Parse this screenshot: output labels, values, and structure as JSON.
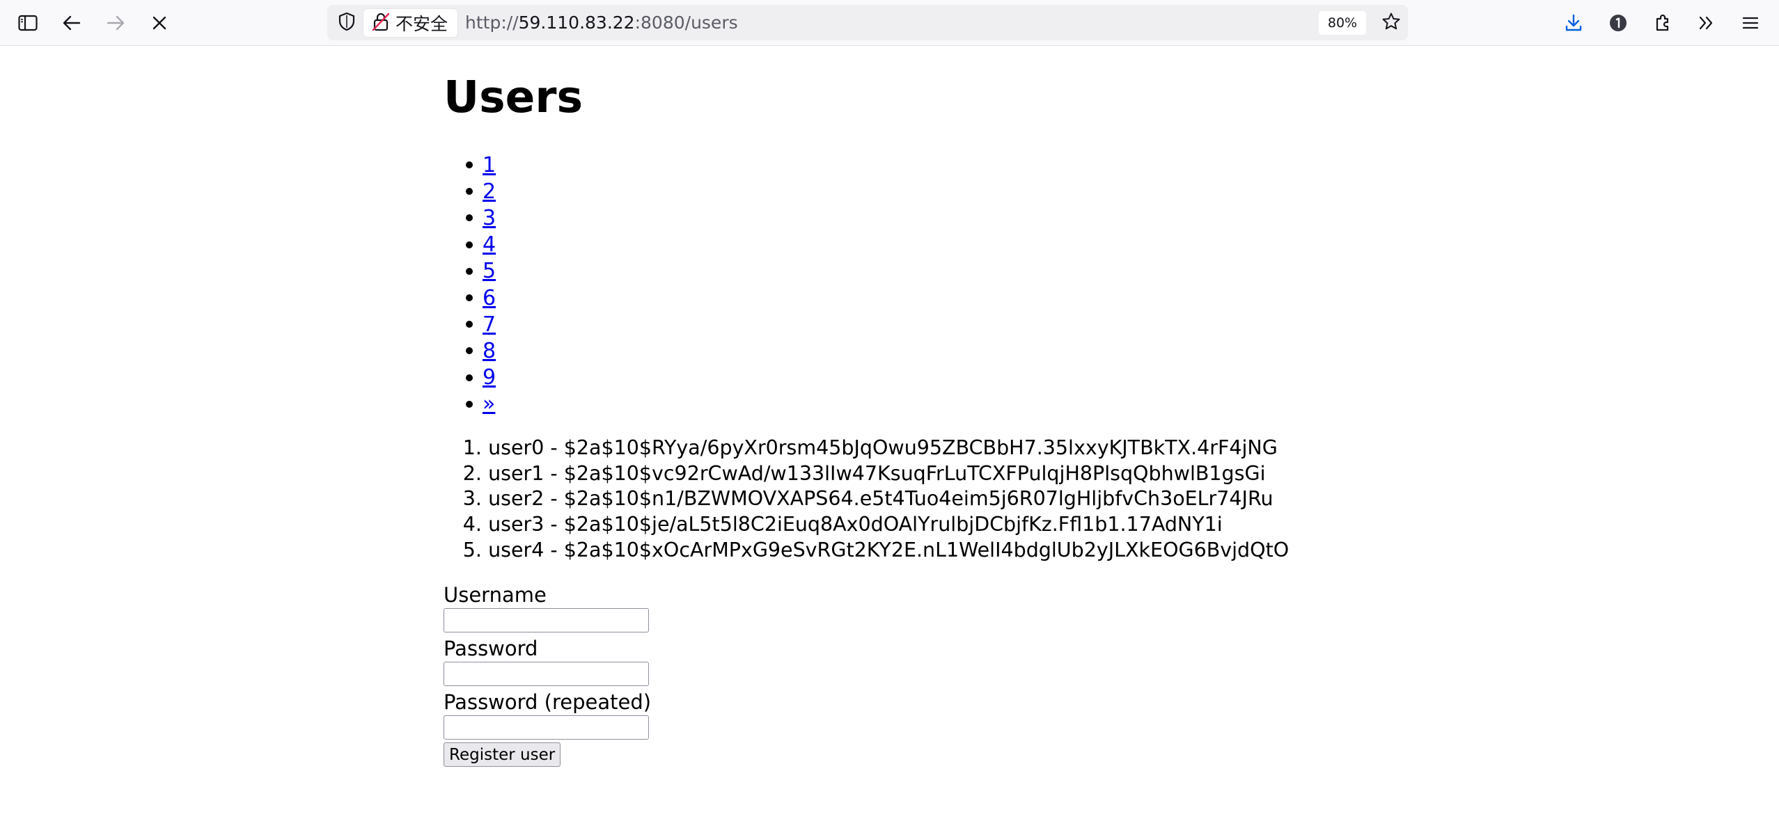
{
  "browser": {
    "insecure_label": "不安全",
    "url_protocol": "http://",
    "url_host": "59.110.83.22",
    "url_path": ":8080/users",
    "zoom": "80%",
    "icons": {
      "sidebar": "sidebar-icon",
      "back": "back-arrow-icon",
      "forward": "forward-arrow-icon",
      "stop": "stop-loading-icon",
      "shield": "shield-icon",
      "lock": "insecure-lock-icon",
      "bookmark": "star-icon",
      "downloads": "download-icon",
      "password": "password-manager-icon",
      "extensions": "extensions-icon",
      "overflow": "overflow-chevrons-icon",
      "menu": "hamburger-menu-icon"
    },
    "accent_color": "#0060df"
  },
  "page": {
    "title": "Users",
    "pagination": [
      "1",
      "2",
      "3",
      "4",
      "5",
      "6",
      "7",
      "8",
      "9",
      "»"
    ],
    "users": [
      {
        "num": "1.",
        "text": "user0 - $2a$10$RYya/6pyXr0rsm45bJqOwu95ZBCBbH7.35lxxyKJTBkTX.4rF4jNG"
      },
      {
        "num": "2.",
        "text": "user1 - $2a$10$vc92rCwAd/w133lIw47KsuqFrLuTCXFPulqjH8PlsqQbhwlB1gsGi"
      },
      {
        "num": "3.",
        "text": "user2 - $2a$10$n1/BZWMOVXAPS64.e5t4Tuo4eim5j6R07lgHljbfvCh3oELr74JRu"
      },
      {
        "num": "4.",
        "text": "user3 - $2a$10$je/aL5t5l8C2iEuq8Ax0dOAlYrulbjDCbjfKz.Ffl1b1.17AdNY1i"
      },
      {
        "num": "5.",
        "text": "user4 - $2a$10$xOcArMPxG9eSvRGt2KY2E.nL1WelI4bdglUb2yJLXkEOG6BvjdQtO"
      }
    ],
    "form": {
      "username_label": "Username",
      "username_value": "",
      "password_label": "Password",
      "password_value": "",
      "password_repeat_label": "Password (repeated)",
      "password_repeat_value": "",
      "submit_label": "Register user"
    },
    "link_color": "#0000ee"
  }
}
